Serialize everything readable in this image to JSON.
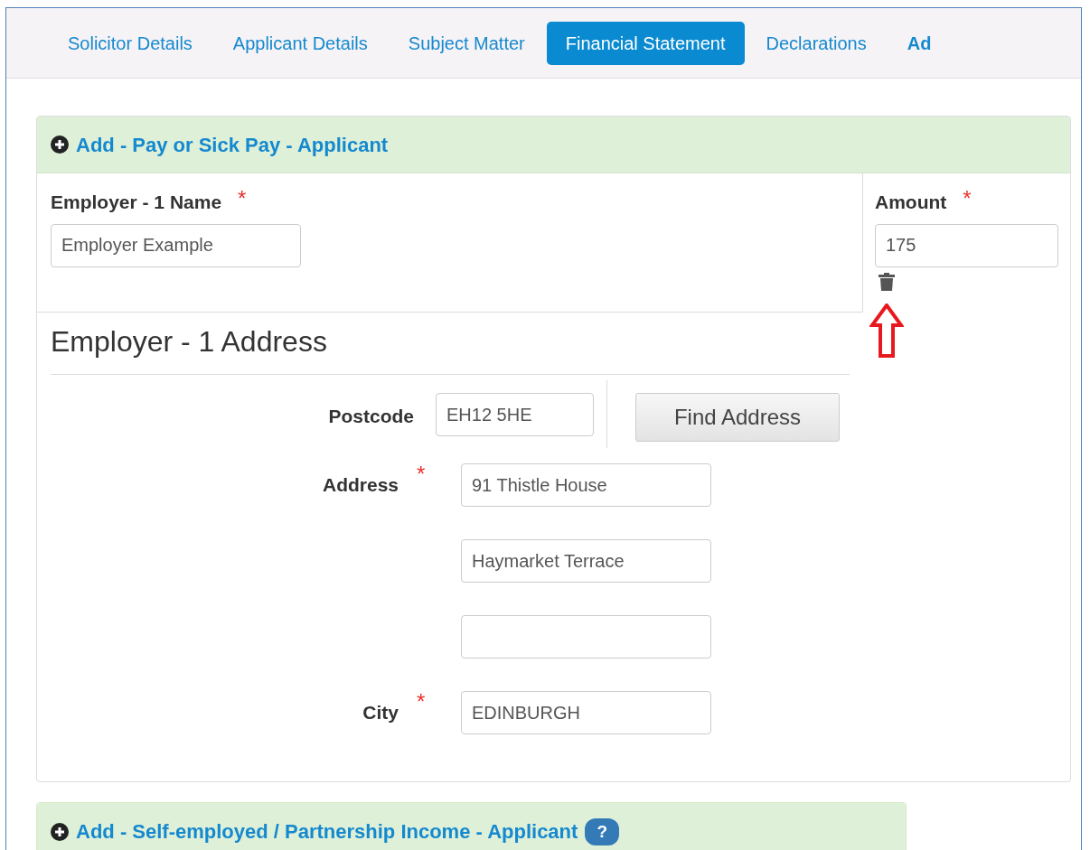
{
  "tabs": [
    {
      "label": "Solicitor Details",
      "selected": false
    },
    {
      "label": "Applicant Details",
      "selected": false
    },
    {
      "label": "Subject Matter",
      "selected": false
    },
    {
      "label": "Financial Statement",
      "selected": true
    },
    {
      "label": "Declarations",
      "selected": false
    },
    {
      "label": "Ad",
      "selected": false
    }
  ],
  "income_panel": {
    "header": "Add - Pay or Sick Pay - Applicant",
    "employer_name": {
      "label": "Employer - 1 Name",
      "required_mark": "*",
      "value": "Employer Example"
    },
    "amount": {
      "label": "Amount",
      "required_mark": "*",
      "value": "175"
    },
    "address_heading": "Employer - 1 Address",
    "address_rows": [
      {
        "kind": "lookup",
        "label": "Postcode",
        "value": "EH12 5HE",
        "button": "Find Address"
      },
      {
        "kind": "text",
        "label": "Address",
        "required_mark": "*",
        "value": "91 Thistle House"
      },
      {
        "kind": "text",
        "value": "Haymarket Terrace"
      },
      {
        "kind": "text",
        "value": ""
      },
      {
        "kind": "text",
        "label": "City",
        "required_mark": "*",
        "value": "EDINBURGH"
      }
    ]
  },
  "second_panel": {
    "header": "Add - Self-employed / Partnership Income - Applicant",
    "help_badge": "?"
  }
}
